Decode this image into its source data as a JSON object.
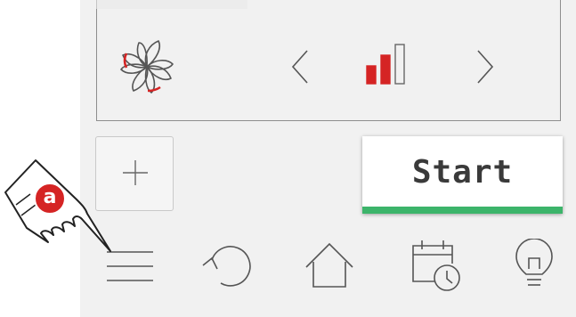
{
  "control_panel": {
    "fan_icon": "fan-icon",
    "prev_icon": "chevron-left-icon",
    "next_icon": "chevron-right-icon",
    "level_icon": "fan-level-icon",
    "level": {
      "active": 2,
      "total": 3
    }
  },
  "actions": {
    "add_icon": "plus-icon",
    "start_label": "Start"
  },
  "bottom_nav": {
    "items": [
      "menu-icon",
      "undo-icon",
      "home-icon",
      "calendar-timer-icon",
      "lightbulb-icon"
    ]
  },
  "annotation": {
    "badge_label": "a",
    "hand_icon": "pointing-hand-icon"
  },
  "colors": {
    "accent_red": "#d52424",
    "start_bar": "#3cb46a",
    "background": "#f1f1f1",
    "icon_stroke": "#4a4a4a"
  }
}
